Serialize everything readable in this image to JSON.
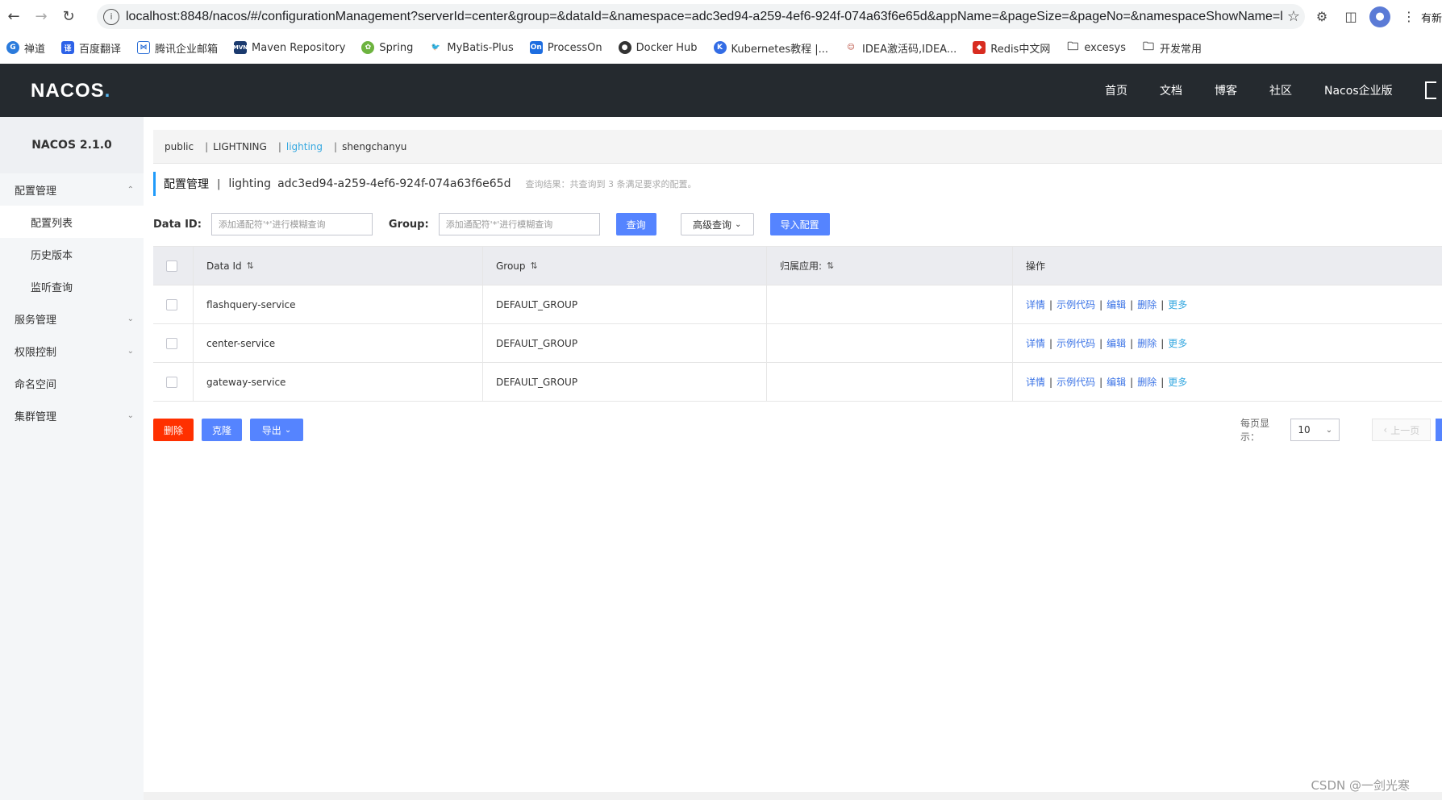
{
  "browser": {
    "url": "localhost:8848/nacos/#/configurationManagement?serverId=center&group=&dataId=&namespace=adc3ed94-a259-4ef6-924f-074a63f6e65d&appName=&pageSize=&pageNo=&namespaceShowName=light...",
    "edge_text": "有新",
    "bookmarks": [
      {
        "label": "禅道",
        "color": "#2b7bdc"
      },
      {
        "label": "百度翻译",
        "color": "#2d62e8"
      },
      {
        "label": "腾讯企业邮箱",
        "color": "#2c6fd6"
      },
      {
        "label": "Maven Repository",
        "color": "#1b3a6e"
      },
      {
        "label": "Spring",
        "color": "#6db33f"
      },
      {
        "label": "MyBatis-Plus",
        "color": "#222222"
      },
      {
        "label": "ProcessOn",
        "color": "#1d6de0"
      },
      {
        "label": "Docker Hub",
        "color": "#333333"
      },
      {
        "label": "Kubernetes教程 |...",
        "color": "#326ce5"
      },
      {
        "label": "IDEA激活码,IDEA...",
        "color": "#b23b2b"
      },
      {
        "label": "Redis中文网",
        "color": "#d82c20"
      },
      {
        "label": "excesys",
        "color": ""
      },
      {
        "label": "开发常用",
        "color": ""
      }
    ]
  },
  "header": {
    "logo": "NACOS",
    "nav": [
      "首页",
      "文档",
      "博客",
      "社区",
      "Nacos企业版"
    ]
  },
  "sidebar": {
    "version": "NACOS 2.1.0",
    "config_management": "配置管理",
    "config_sub": [
      "配置列表",
      "历史版本",
      "监听查询"
    ],
    "other_menus": [
      "服务管理",
      "权限控制",
      "命名空间",
      "集群管理"
    ]
  },
  "namespaces": [
    "public",
    "LIGHTNING",
    "lighting",
    "shengchanyu"
  ],
  "active_namespace": "lighting",
  "title": {
    "main": "配置管理",
    "separator": "|",
    "ns_name": "lighting",
    "ns_id": "adc3ed94-a259-4ef6-924f-074a63f6e65d",
    "result": "查询结果：共查询到 3 条满足要求的配置。"
  },
  "search": {
    "data_id_label": "Data ID:",
    "data_id_placeholder": "添加通配符'*'进行模糊查询",
    "group_label": "Group:",
    "group_placeholder": "添加通配符'*'进行模糊查询",
    "query_btn": "查询",
    "advanced_btn": "高级查询",
    "import_btn": "导入配置"
  },
  "table": {
    "columns": [
      "Data Id",
      "Group",
      "归属应用:",
      "操作"
    ],
    "rows": [
      {
        "data_id": "flashquery-service",
        "group": "DEFAULT_GROUP",
        "app": ""
      },
      {
        "data_id": "center-service",
        "group": "DEFAULT_GROUP",
        "app": ""
      },
      {
        "data_id": "gateway-service",
        "group": "DEFAULT_GROUP",
        "app": ""
      }
    ],
    "actions": [
      "详情",
      "示例代码",
      "编辑",
      "删除",
      "更多"
    ]
  },
  "bottom": {
    "delete_btn": "删除",
    "clone_btn": "克隆",
    "export_btn": "导出",
    "page_size_label": "每页显示：",
    "page_size": "10",
    "prev_btn": "上一页"
  },
  "watermark": "CSDN @一剑光寒",
  "colors": {
    "header_bg": "#252a2f",
    "primary": "#5584ff",
    "danger": "#ff3000",
    "link": "#3c74e6",
    "active_ns": "#35a8e0"
  }
}
